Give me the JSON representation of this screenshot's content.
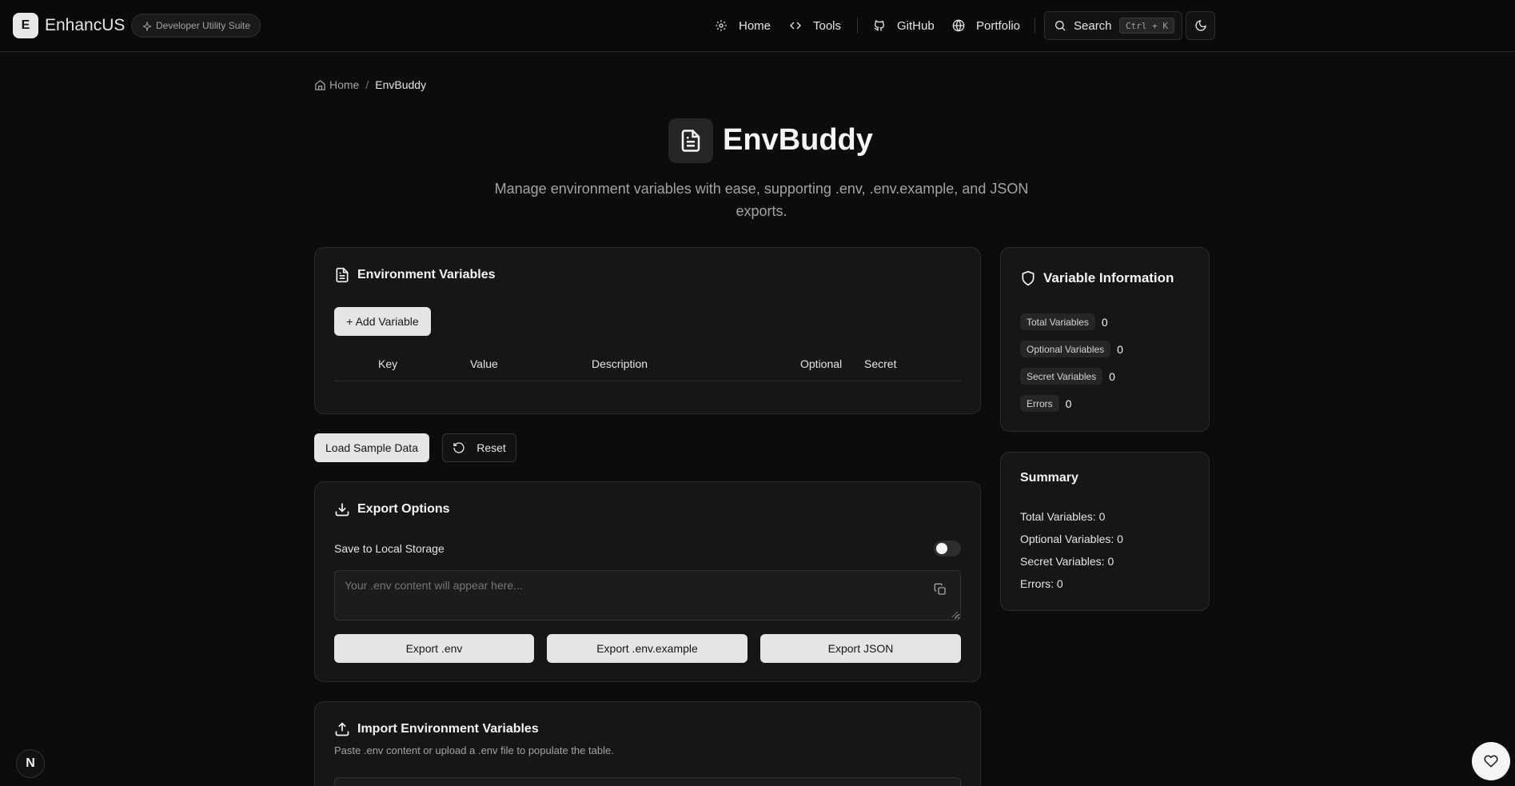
{
  "header": {
    "logo_letter": "E",
    "brand": "EnhancUS",
    "suite_badge": "Developer Utility Suite",
    "nav": [
      {
        "label": "Home",
        "icon": "gear-icon"
      },
      {
        "label": "Tools",
        "icon": "code-icon"
      },
      {
        "label": "GitHub",
        "icon": "github-icon"
      },
      {
        "label": "Portfolio",
        "icon": "globe-icon"
      }
    ],
    "search": {
      "label": "Search",
      "shortcut": "Ctrl + K"
    }
  },
  "breadcrumb": {
    "home": "Home",
    "separator": "/",
    "current": "EnvBuddy"
  },
  "page": {
    "title": "EnvBuddy",
    "subtitle": "Manage environment variables with ease, supporting .env, .env.example, and JSON exports."
  },
  "env_card": {
    "title": "Environment Variables",
    "add_button": "+ Add Variable",
    "columns": [
      "Key",
      "Value",
      "Description",
      "Optional",
      "Secret"
    ]
  },
  "actions": {
    "load_sample": "Load Sample Data",
    "reset": "Reset"
  },
  "export_card": {
    "title": "Export Options",
    "save_local_label": "Save to Local Storage",
    "save_local_enabled": false,
    "output_placeholder": "Your .env content will appear here...",
    "buttons": [
      "Export .env",
      "Export .env.example",
      "Export JSON"
    ]
  },
  "import_card": {
    "title": "Import Environment Variables",
    "description": "Paste .env content or upload a .env file to populate the table."
  },
  "info_card": {
    "title": "Variable Information",
    "rows": [
      {
        "label": "Total Variables",
        "value": "0"
      },
      {
        "label": "Optional Variables",
        "value": "0"
      },
      {
        "label": "Secret Variables",
        "value": "0"
      },
      {
        "label": "Errors",
        "value": "0"
      }
    ]
  },
  "summary_card": {
    "title": "Summary",
    "lines": [
      "Total Variables: 0",
      "Optional Variables: 0",
      "Secret Variables: 0",
      "Errors: 0"
    ]
  },
  "fab": {
    "left_letter": "N"
  },
  "colors": {
    "background": "#0c0c0c",
    "card": "#161616",
    "border": "#2a2a2a",
    "button_light": "#e5e5e5"
  }
}
